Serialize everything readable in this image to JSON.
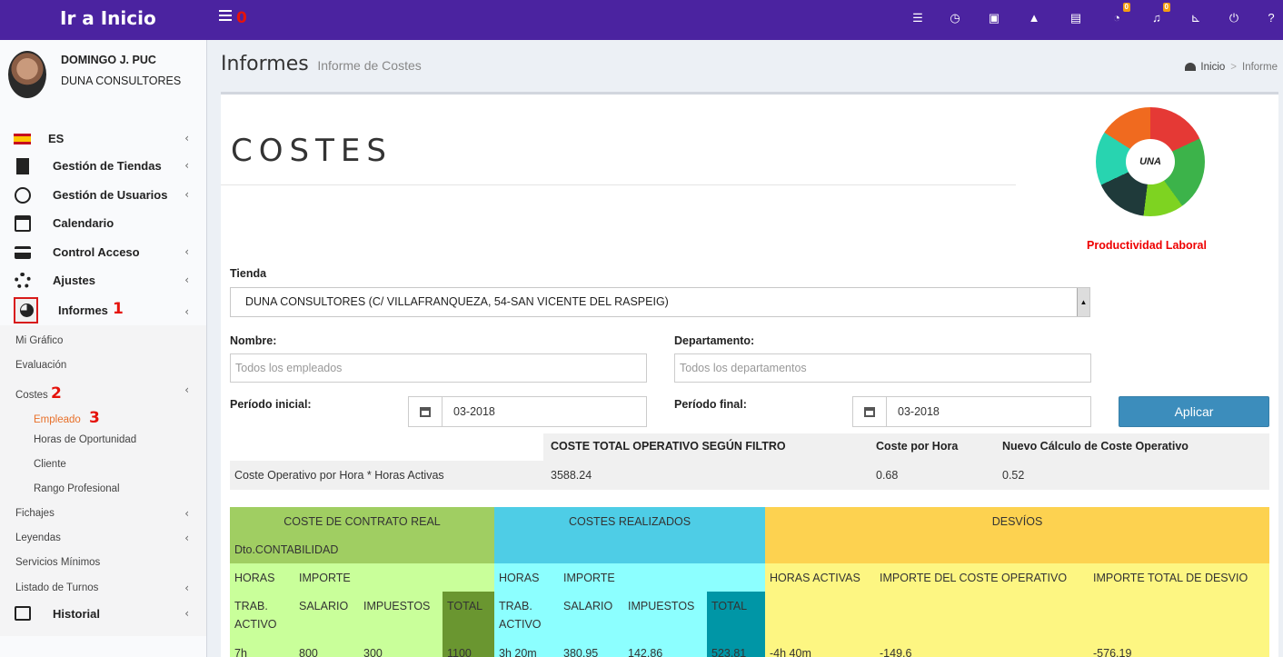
{
  "topbar": {
    "brand": "Ir a Inicio",
    "annotation": "0",
    "icons": [
      {
        "name": "list-icon",
        "glyph": "☰"
      },
      {
        "name": "clock-icon",
        "glyph": "◷"
      },
      {
        "name": "calendar-check-icon",
        "glyph": "▣"
      },
      {
        "name": "road-icon",
        "glyph": "▲"
      },
      {
        "name": "newspaper-icon",
        "glyph": "▤"
      },
      {
        "name": "comments-icon",
        "glyph": "◔",
        "badge": "0"
      },
      {
        "name": "bell-icon",
        "glyph": "♫",
        "badge": "0"
      },
      {
        "name": "cart-icon",
        "glyph": "⊾"
      },
      {
        "name": "power-icon",
        "glyph": "⏻"
      },
      {
        "name": "help-icon",
        "glyph": "?"
      }
    ]
  },
  "user": {
    "name": "DOMINGO J. PUC",
    "company": "DUNA CONSULTORES"
  },
  "sidebar": {
    "language": "ES",
    "items": {
      "tiendas": "Gestión de Tiendas",
      "usuarios": "Gestión de Usuarios",
      "calendario": "Calendario",
      "acceso": "Control Acceso",
      "ajustes": "Ajustes",
      "informes": "Informes",
      "historial": "Historial"
    },
    "sub": {
      "mi_grafico": "Mi Gráfico",
      "evaluacion": "Evaluación",
      "costes": "Costes",
      "empleado": "Empleado",
      "horas": "Horas de Oportunidad",
      "cliente": "Cliente",
      "rango": "Rango Profesional",
      "fichajes": "Fichajes",
      "leyendas": "Leyendas",
      "servicios": "Servicios Mínimos",
      "turnos": "Listado de Turnos"
    },
    "annotations": {
      "a1": "1",
      "a2": "2",
      "a3": "3"
    }
  },
  "header": {
    "title": "Informes",
    "subtitle": "Informe de Costes"
  },
  "breadcrumb": {
    "home": "Inicio",
    "sep": ">",
    "current": "Informe"
  },
  "panel": {
    "title": "COSTES",
    "logo_text": "UNA",
    "logo_caption": "Productividad Laboral",
    "tienda_label": "Tienda",
    "tienda_value": "DUNA CONSULTORES (C/ VILLAFRANQUEZA, 54-SAN VICENTE DEL RASPEIG)",
    "nombre_label": "Nombre:",
    "nombre_placeholder": "Todos los empleados",
    "depto_label": "Departamento:",
    "depto_placeholder": "Todos los departamentos",
    "inicio_label": "Período inicial:",
    "inicio_value": "03-2018",
    "final_label": "Período final:",
    "final_value": "03-2018",
    "apply": "Aplicar"
  },
  "summary": {
    "headers": [
      "COSTE TOTAL OPERATIVO SEGÚN FILTRO",
      "Coste por Hora",
      "Nuevo Cálculo de Coste Operativo"
    ],
    "row_label": "Coste Operativo por Hora * Horas Activas",
    "values": [
      "3588.24",
      "0.68",
      "0.52"
    ]
  },
  "table": {
    "group1": "COSTE DE CONTRATO REAL",
    "group2": "COSTES REALIZADOS",
    "group3": "DESVÍOS",
    "dept": "Dto.CONTABILIDAD",
    "horas": "HORAS",
    "importe": "IMPORTE",
    "horas_activas": "HORAS ACTIVAS",
    "importe_coste_op": "IMPORTE DEL COSTE OPERATIVO",
    "importe_total_desvio": "IMPORTE TOTAL DE DESVIO",
    "trab": "TRAB.",
    "activo": "ACTIVO",
    "salario": "SALARIO",
    "impuestos": "IMPUESTOS",
    "total": "TOTAL",
    "row": {
      "horas1": "7h",
      "salario1": "800",
      "impuestos1": "300",
      "total1": "1100",
      "horas2": "3h 20m",
      "salario2": "380.95",
      "impuestos2": "142.86",
      "total2": "523.81",
      "desvio_horas": "-4h 40m",
      "desvio_coste": "-149.6",
      "desvio_total": "-576.19"
    }
  }
}
